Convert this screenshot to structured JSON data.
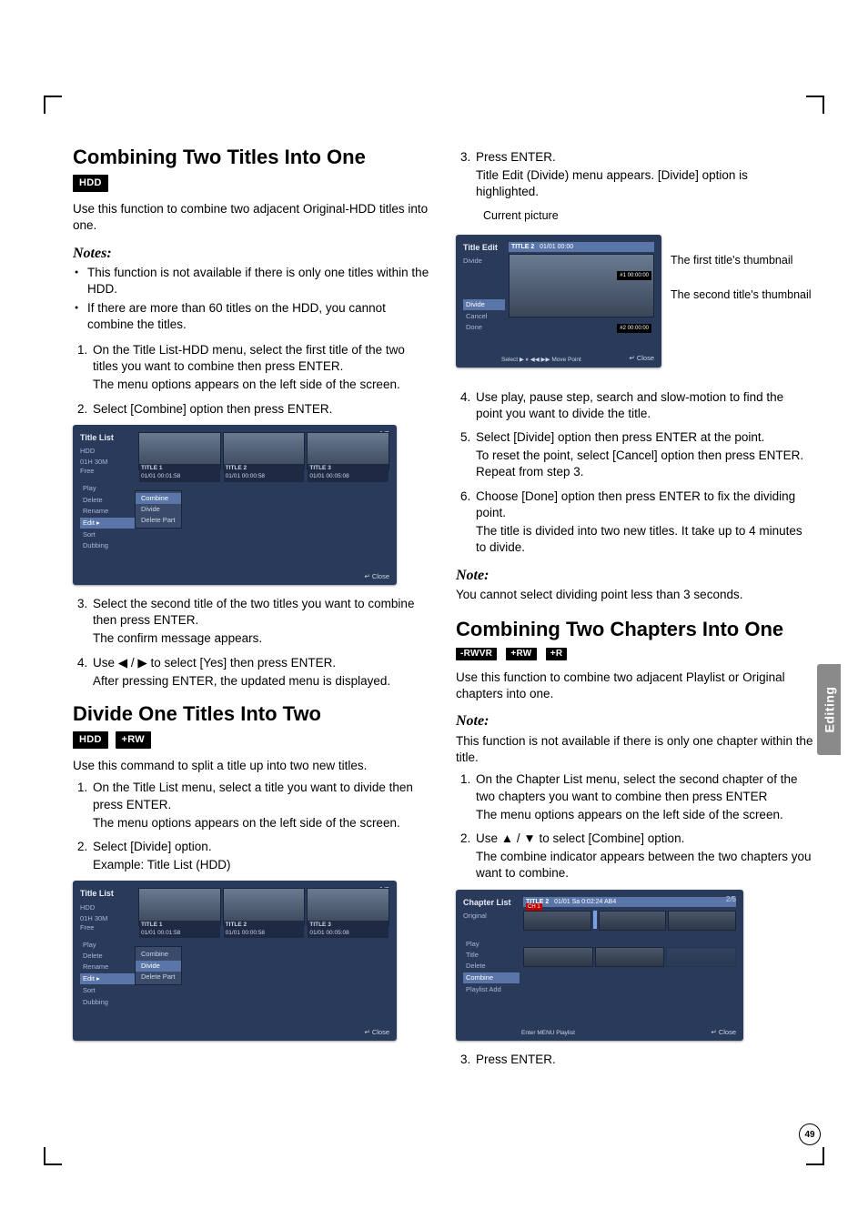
{
  "page_number": "49",
  "side_tab": "Editing",
  "left": {
    "sec1": {
      "title": "Combining Two Titles Into One",
      "tag1": "HDD",
      "intro": "Use this function to combine two adjacent Original-HDD titles into one.",
      "notes_h": "Notes:",
      "bullet1": "This function is not available if there is only one titles within the HDD.",
      "bullet2": "If there are more than 60 titles on the HDD, you cannot combine the titles.",
      "step1a": "On the Title List-HDD menu, select the first title of the two titles you want to combine then press ENTER.",
      "step1b": "The menu options appears on the left side of the screen.",
      "step2": "Select [Combine] option then press ENTER.",
      "step3a": "Select the second title of the two titles you want to combine then press ENTER.",
      "step3b": "The confirm message appears.",
      "step4a": "Use ◀ / ▶ to select [Yes] then press ENTER.",
      "step4b": "After pressing ENTER, the updated menu is displayed."
    },
    "sec2": {
      "title": "Divide One Titles Into Two",
      "tag1": "HDD",
      "tag2": "+RW",
      "intro": "Use this command to split a title up into two new titles.",
      "step1a": "On the Title List menu, select a title you want to divide then press ENTER.",
      "step1b": "The menu options appears on the left side of the screen.",
      "step2a": "Select [Divide] option.",
      "step2b": "Example: Title List (HDD)"
    },
    "ui1": {
      "header": "Title List",
      "sub": "HDD",
      "free_a": "01H 30M",
      "free_b": "Free",
      "pager": "1/3",
      "t1": "TITLE 1",
      "t1b": "01/01   00:01:58",
      "t2": "TITLE 2",
      "t2b": "01/01   00:00:58",
      "t3": "TITLE 3",
      "t3b": "01/01   00:05:08",
      "m_play": "Play",
      "m_del": "Delete",
      "m_ren": "Rename",
      "m_edit": "Edit",
      "m_sort": "Sort",
      "m_dub": "Dubbing",
      "sm_combine": "Combine",
      "sm_divide": "Divide",
      "sm_delpart": "Delete Part",
      "close": "↵ Close"
    }
  },
  "right": {
    "cont": {
      "step3a": "Press ENTER.",
      "step3b": "Title Edit (Divide) menu appears. [Divide] option is highlighted.",
      "caption": "Current picture",
      "lbl1": "The first title's thumbnail",
      "lbl2": "The second title's thumbnail",
      "step4": "Use play, pause step, search and slow-motion to find the point you want to divide the title.",
      "step5a": "Select [Divide] option then press ENTER at the point.",
      "step5b": "To reset the point, select [Cancel] option then press ENTER. Repeat from step 3.",
      "step6a": "Choose [Done] option then press ENTER to fix the dividing point.",
      "step6b": "The title is divided into two new titles. It take up to 4 minutes to divide.",
      "note_h": "Note:",
      "note": "You cannot select dividing point less than 3 seconds."
    },
    "sec3": {
      "title": "Combining Two Chapters Into One",
      "tag1": "-RWVR",
      "tag2": "+RW",
      "tag3": "+R",
      "intro": "Use this function to combine two adjacent Playlist or Original chapters into one.",
      "note_h": "Note:",
      "note": "This function is not available if there is only one chapter within the title.",
      "step1a": "On the Chapter List menu, select the second chapter of the two chapters you want to combine then press ENTER",
      "step1b": "The menu options appears on the left side of the screen.",
      "step2a": "Use ▲ / ▼ to select [Combine] option.",
      "step2b": "The combine indicator appears between the two chapters you want to combine.",
      "step3": "Press ENTER."
    },
    "ui_div": {
      "header": "Title Edit",
      "sub": "Divide",
      "t2": "TITLE 2",
      "t2b": "01/01   00:00",
      "m_div": "Divide",
      "m_can": "Cancel",
      "m_done": "Done",
      "tc1": "#1   00:00:00",
      "tc2": "#2   00:00:00",
      "hint": "Select   ▶ ⏸ ◀◀ ▶▶ Move Point",
      "close": "↵ Close"
    },
    "ui_ch": {
      "header": "Chapter List",
      "sub": "Original",
      "t2": "TITLE 2",
      "t2b": "01/01 Sa 0:02:24    AB4",
      "pager": "2/5",
      "m_play": "Play",
      "m_title": "Title",
      "m_del": "Delete",
      "m_comb": "Combine",
      "m_pl": "Playlist Add",
      "hint": "Enter  MENU Playlist",
      "close": "↵ Close",
      "badge": "CH 1"
    }
  }
}
